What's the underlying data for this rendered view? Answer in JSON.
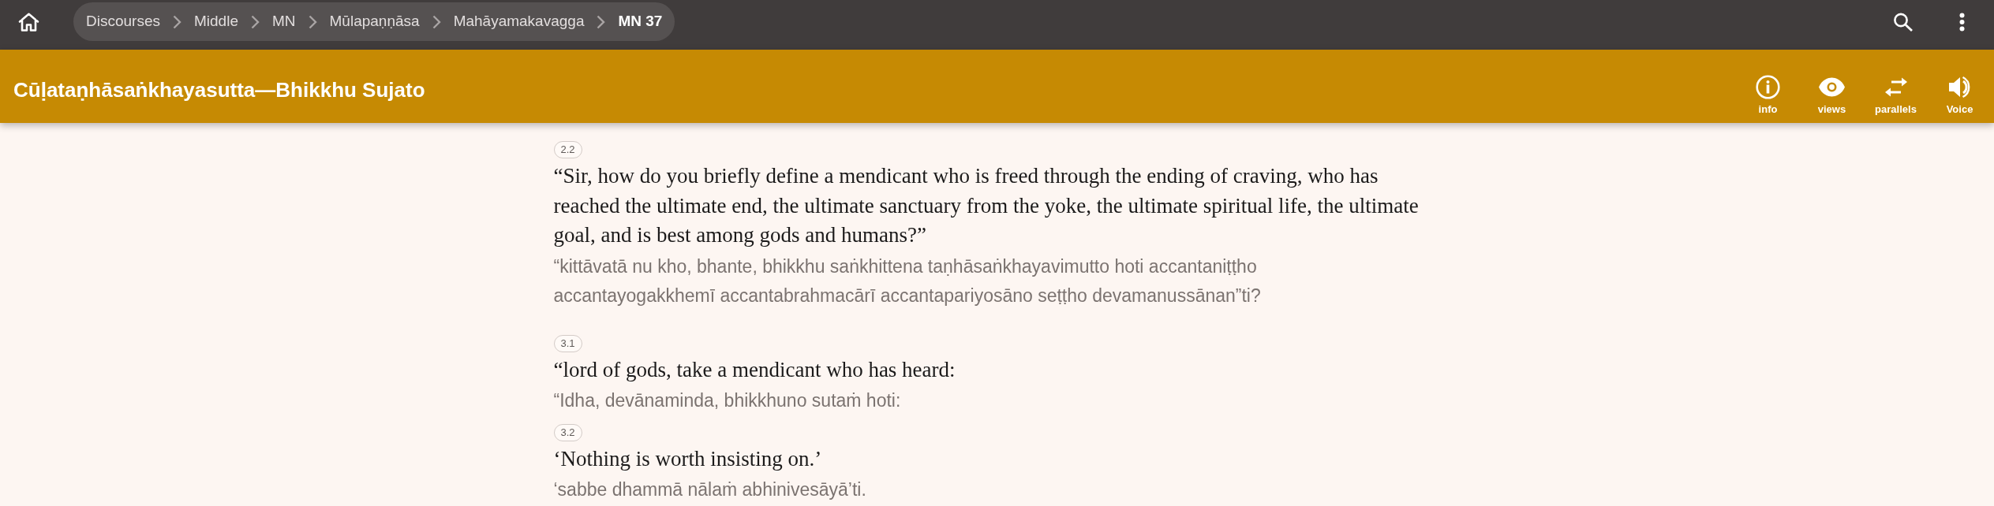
{
  "top_bar": {
    "breadcrumbs": [
      {
        "label": "Discourses",
        "current": false
      },
      {
        "label": "Middle",
        "current": false
      },
      {
        "label": "MN",
        "current": false
      },
      {
        "label": "Mūlapaṇṇāsa",
        "current": false
      },
      {
        "label": "Mahāyamakavagga",
        "current": false
      },
      {
        "label": "MN 37",
        "current": true
      }
    ]
  },
  "title_bar": {
    "title": "Cūḷataṇhāsaṅkhayasutta—Bhikkhu Sujato",
    "actions": [
      {
        "kind": "info",
        "label": "info"
      },
      {
        "kind": "views",
        "label": "views"
      },
      {
        "kind": "parallels",
        "label": "parallels"
      },
      {
        "kind": "voice",
        "label": "Voice"
      }
    ]
  },
  "paragraphs": [
    {
      "segments": [
        {
          "number": "2.2",
          "translation": "“Sir, how do you briefly define a mendicant who is freed through the ending of craving, who has reached the ultimate end, the ultimate sanctuary from the yoke, the ultimate spiritual life, the ultimate goal, and is best among gods and humans?”",
          "root_text": "“kittāvatā nu kho, bhante, bhikkhu saṅkhittena taṇhāsaṅkhayavimutto hoti accantaniṭṭho accantayogakkhemī accantabrahmacārī accantapariyosāno seṭṭho devamanussānan”ti?"
        }
      ]
    },
    {
      "segments": [
        {
          "number": "3.1",
          "translation": "“lord of gods, take a mendicant who has heard:",
          "root_text": "“Idha, devānaminda, bhikkhuno sutaṁ hoti:"
        },
        {
          "number": "3.2",
          "translation": "‘Nothing is worth insisting on.’",
          "root_text": "‘sabbe dhammā nālaṁ abhinivesāyā’ti."
        }
      ]
    }
  ]
}
